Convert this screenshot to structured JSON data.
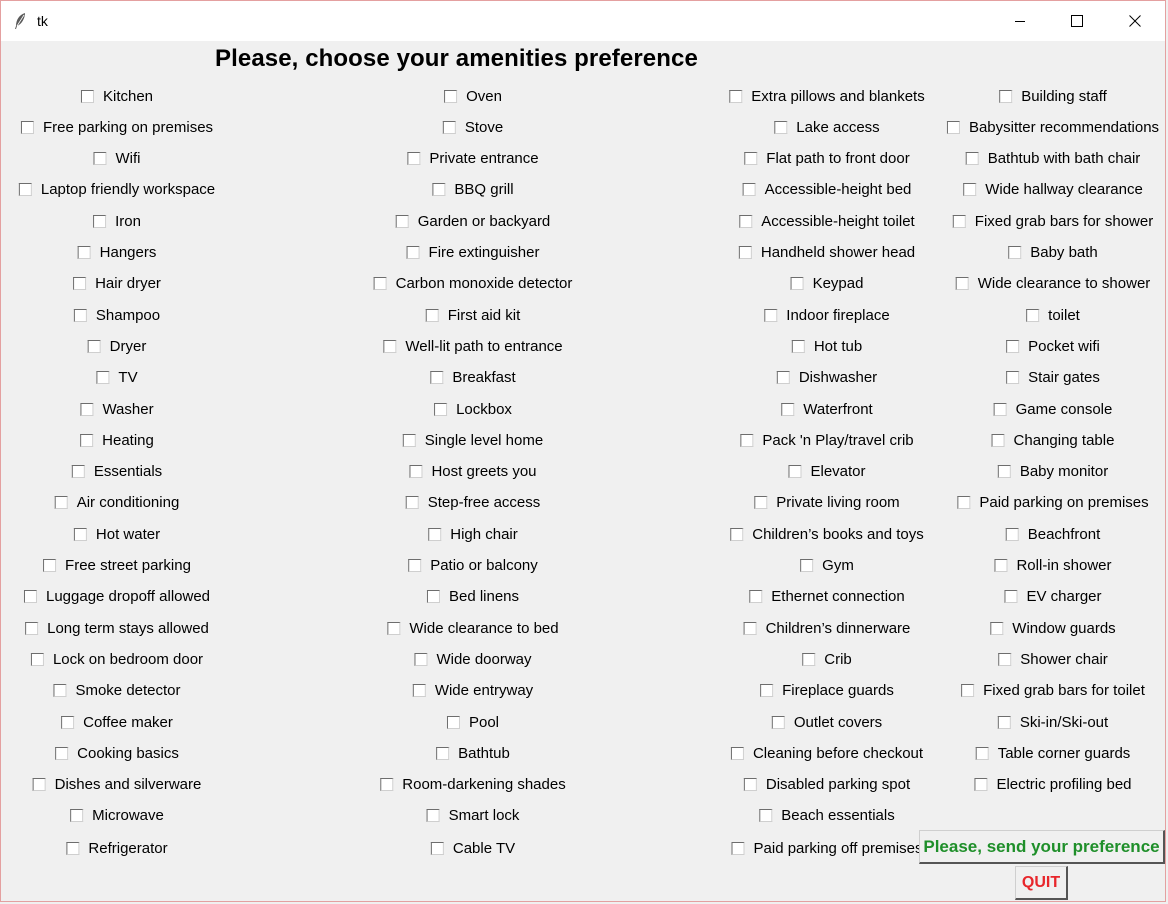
{
  "window": {
    "title": "tk",
    "icon": "feather-icon",
    "controls": [
      "minimize-icon",
      "maximize-icon",
      "close-icon"
    ]
  },
  "heading": "Please, choose your amenities preference",
  "columns": [
    [
      "Kitchen",
      "Free parking on premises",
      "Wifi",
      "Laptop friendly workspace",
      "Iron",
      "Hangers",
      "Hair dryer",
      "Shampoo",
      "Dryer",
      "TV",
      "Washer",
      "Heating",
      "Essentials",
      "Air conditioning",
      "Hot water",
      "Free street parking",
      "Luggage dropoff allowed",
      "Long term stays allowed",
      "Lock on bedroom door",
      "Smoke detector",
      "Coffee maker",
      "Cooking basics",
      "Dishes and silverware",
      "Microwave",
      "Refrigerator"
    ],
    [
      "Oven",
      "Stove",
      "Private entrance",
      "BBQ grill",
      "Garden or backyard",
      "Fire extinguisher",
      "Carbon monoxide detector",
      "First aid kit",
      "Well-lit path to entrance",
      "Breakfast",
      "Lockbox",
      "Single level home",
      "Host greets you",
      "Step-free access",
      "High chair",
      "Patio or balcony",
      "Bed linens",
      "Wide clearance to bed",
      "Wide doorway",
      "Wide entryway",
      "Pool",
      "Bathtub",
      "Room-darkening shades",
      "Smart lock",
      "Cable TV"
    ],
    [
      "Extra pillows and blankets",
      "Lake access",
      "Flat path to front door",
      "Accessible-height bed",
      "Accessible-height toilet",
      "Handheld shower head",
      "Keypad",
      "Indoor fireplace",
      "Hot tub",
      "Dishwasher",
      "Waterfront",
      "Pack 'n Play/travel crib",
      "Elevator",
      "Private living room",
      "Children’s books and toys",
      "Gym",
      "Ethernet connection",
      "Children’s dinnerware",
      "Crib",
      "Fireplace guards",
      "Outlet covers",
      "Cleaning before checkout",
      "Disabled parking spot",
      "Beach essentials",
      "Paid parking off premises"
    ],
    [
      "Building staff",
      "Babysitter recommendations",
      "Bathtub with bath chair",
      "Wide hallway clearance",
      "Fixed grab bars for shower",
      "Baby bath",
      "Wide clearance to shower",
      "toilet",
      "Pocket wifi",
      "Stair gates",
      "Game console",
      "Changing table",
      "Baby monitor",
      "Paid parking on premises",
      "Beachfront",
      "Roll-in shower",
      "EV charger",
      "Window guards",
      "Shower chair",
      "Fixed grab bars for toilet",
      "Ski-in/Ski-out",
      "Table corner guards",
      "Electric profiling bed"
    ]
  ],
  "buttons": {
    "send": "Please, send your preference",
    "quit": "QUIT"
  },
  "colors": {
    "send_text": "#1f8f2a",
    "quit_text": "#e8262b",
    "background": "#f0f0f0"
  }
}
